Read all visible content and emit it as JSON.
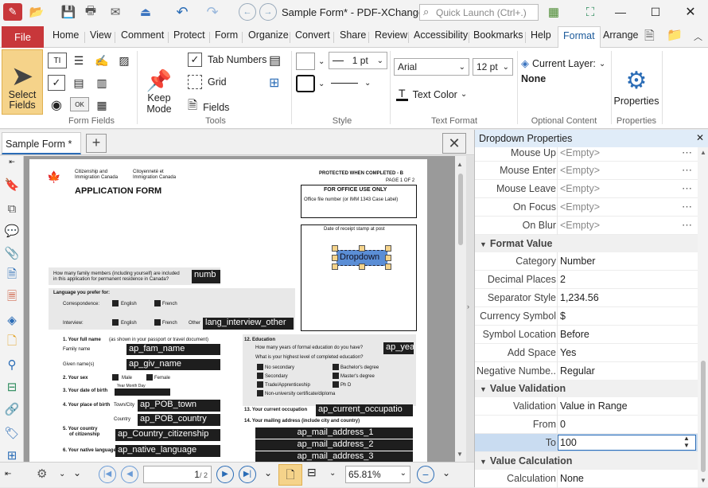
{
  "app": {
    "title": "Sample Form* - PDF-XChange ..",
    "quick_launch_placeholder": "Quick Launch (Ctrl+.)"
  },
  "menu": {
    "file": "File",
    "tabs": [
      "Home",
      "View",
      "Comment",
      "Protect",
      "Form",
      "Organize",
      "Convert",
      "Share",
      "Review",
      "Accessibility",
      "Bookmarks",
      "Help",
      "Format",
      "Arrange"
    ],
    "active_tab": "Format"
  },
  "ribbon": {
    "select_fields": "Select\nFields",
    "keep_mode": "Keep\nMode",
    "tab_numbers": "Tab Numbers",
    "grid": "Grid",
    "fields": "Fields",
    "line_width": "1 pt",
    "font": "Arial",
    "font_size": "12 pt",
    "text_color": "Text Color",
    "current_layer_label": "Current Layer:",
    "current_layer_value": "None",
    "properties": "Properties",
    "groups": {
      "form_fields": "Form Fields",
      "tools": "Tools",
      "style": "Style",
      "text_format": "Text Format",
      "optional_content": "Optional Content",
      "properties": "Properties"
    }
  },
  "doc": {
    "tab_label": "Sample Form *",
    "page_current": "1",
    "page_total": "/ 2",
    "zoom": "65.81%"
  },
  "pdf": {
    "org1": "Citizenship and",
    "org2": "Immigration Canada",
    "org3": "Citoyenneté et",
    "org4": "Immigration Canada",
    "heading": "APPLICATION FORM",
    "protected": "PROTECTED WHEN COMPLETED - B",
    "page_of": "PAGE 1 OF 2",
    "office_use": "FOR OFFICE USE ONLY",
    "office_file": "Office file number (or IMM 1343 Case Label)",
    "receipt": "Date of receipt stamp at post",
    "dropdown": "Dropdown",
    "family_q1": "How many family members (including yourself) are included",
    "family_q2": "in this application for permanent residence in Canada?",
    "numb": "numb",
    "lang_pref": "Language you prefer for:",
    "correspondence": "Correspondence:",
    "english": "English",
    "french": "French",
    "interview": "Interview:",
    "other": "Other",
    "lang_interview_other": "lang_interview_other",
    "q1": "1.   Your full name",
    "q1_hint": "(as shown in your passport or travel document)",
    "family_name": "Family name",
    "given_names": "Given name(s)",
    "ap_fam_name": "ap_fam_name",
    "ap_giv_name": "ap_giv_name",
    "q2": "2.   Your sex",
    "male": "Male",
    "female": "Female",
    "q3": "3.   Your date of birth",
    "dob_parts": "Year  Month  Day",
    "q4": "4.   Your place of birth",
    "town_city": "Town/City",
    "country": "Country",
    "ap_pob_town": "ap_POB_town",
    "ap_pob_country": "ap_POB_country",
    "q5a": "5.   Your country",
    "q5b": "of citizenship",
    "ap_country_citizenship": "ap_Country_citizenship",
    "q6": "6.   Your native language",
    "ap_native_language": "ap_native_language",
    "q12": "12.  Education",
    "q12_a": "How many years of formal education do you have?",
    "ap_yea": "ap_yea",
    "q12_b": "What is your highest level of completed education?",
    "edu": [
      "No secondary",
      "Secondary",
      "Trade/Apprenticeship",
      "Non-university certificate/diploma",
      "Bachelor's degree",
      "Master's degree",
      "Ph D"
    ],
    "q13": "13.  Your current occupation",
    "ap_current_occupation": "ap_current_occupatio",
    "q14": "14.  Your mailing address (include city and country)",
    "mail": [
      "ap_mail_address_1",
      "ap_mail_address_2",
      "ap_mail_address_3"
    ]
  },
  "panel": {
    "title": "Dropdown Properties",
    "rows_top": [
      {
        "name": "Mouse Up",
        "value": "<Empty>"
      },
      {
        "name": "Mouse Enter",
        "value": "<Empty>"
      },
      {
        "name": "Mouse Leave",
        "value": "<Empty>"
      },
      {
        "name": "On Focus",
        "value": "<Empty>"
      },
      {
        "name": "On Blur",
        "value": "<Empty>"
      }
    ],
    "section_format": "Format Value",
    "rows_format": [
      {
        "name": "Category",
        "value": "Number"
      },
      {
        "name": "Decimal Places",
        "value": "2"
      },
      {
        "name": "Separator Style",
        "value": "1,234.56"
      },
      {
        "name": "Currency Symbol",
        "value": "$"
      },
      {
        "name": "Symbol Location",
        "value": "Before"
      },
      {
        "name": "Add Space",
        "value": "Yes"
      },
      {
        "name": "Negative Numbe..",
        "value": "Regular"
      }
    ],
    "section_validation": "Value Validation",
    "rows_validation": [
      {
        "name": "Validation",
        "value": "Value in Range"
      },
      {
        "name": "From",
        "value": "0"
      },
      {
        "name": "To",
        "value": "100"
      }
    ],
    "section_calculation": "Value Calculation",
    "rows_calc": [
      {
        "name": "Calculation",
        "value": "None"
      }
    ]
  },
  "colors": {
    "file_tab": "#c8373a",
    "accent": "#2a6cb6",
    "selected_row": "#c9dcf1"
  }
}
